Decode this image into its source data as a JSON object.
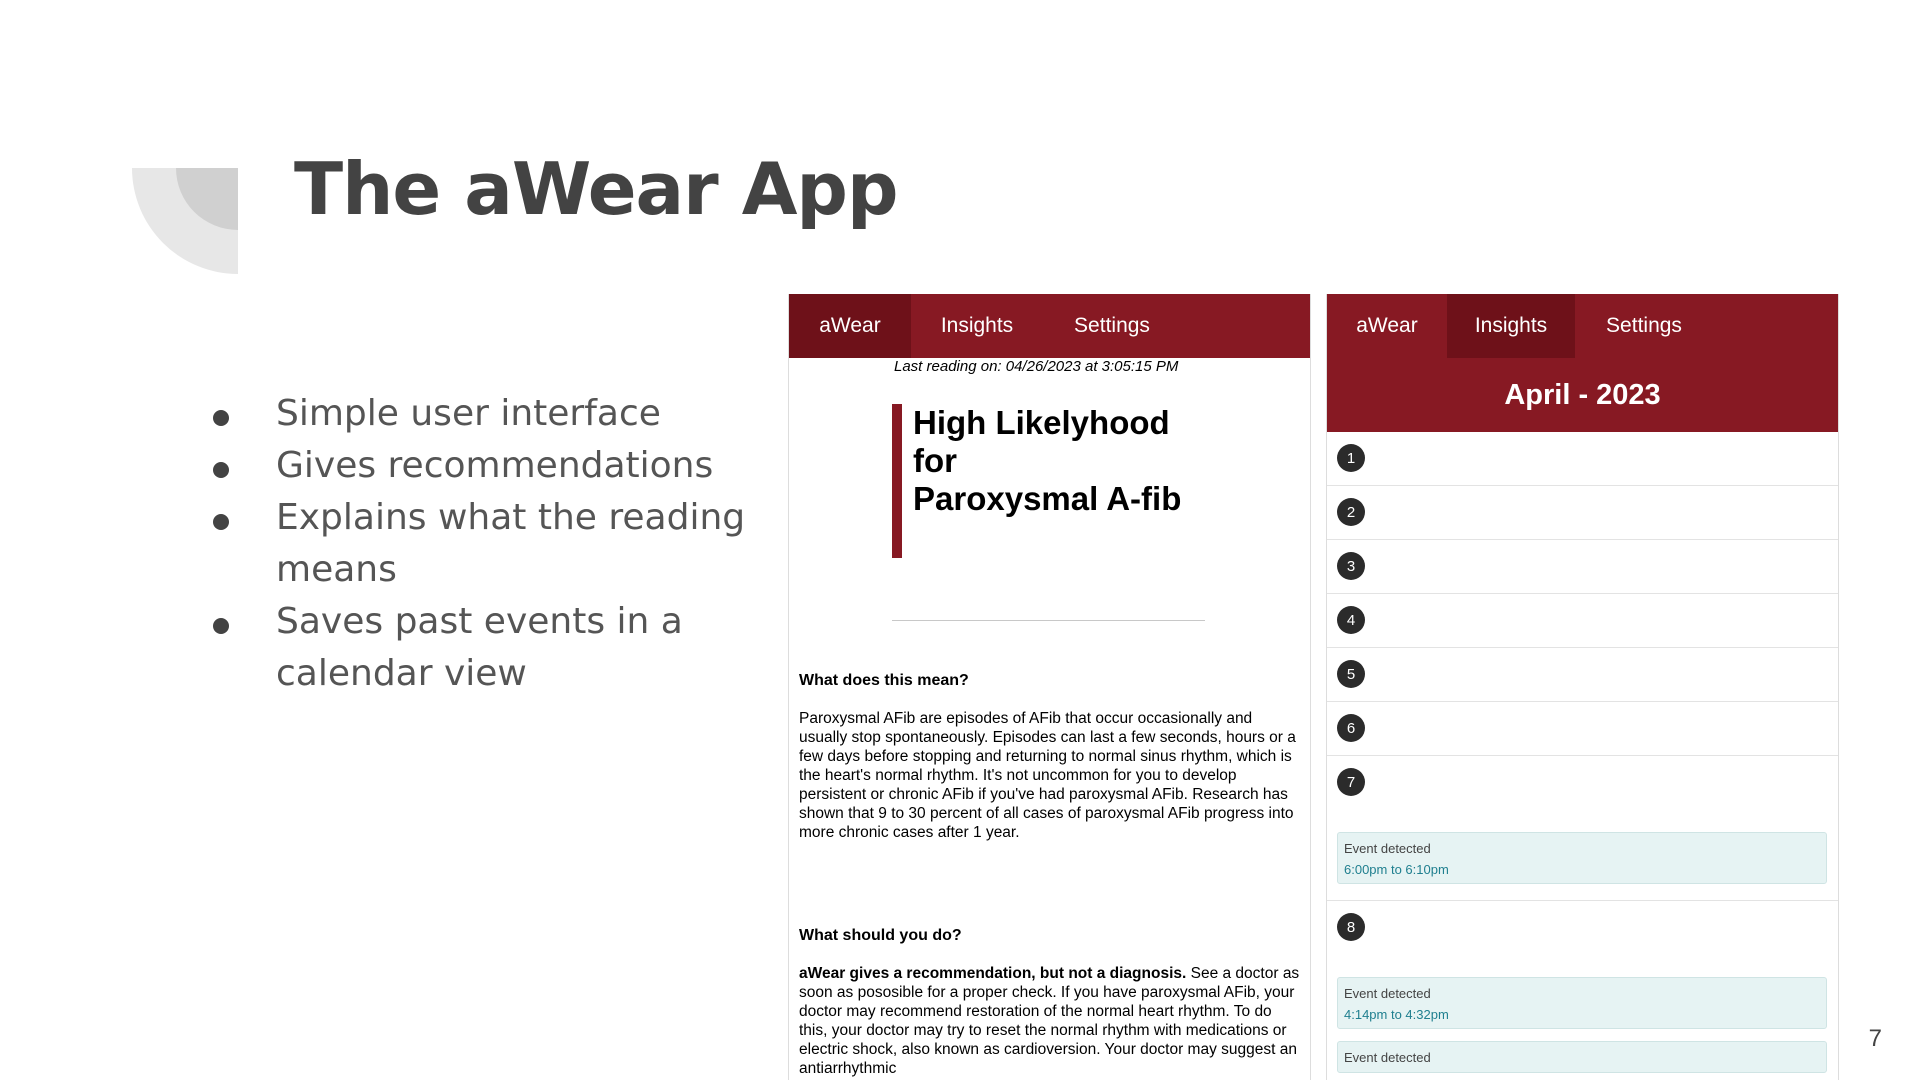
{
  "slide": {
    "title": "The aWear App",
    "bullets": [
      "Simple user interface",
      "Gives recommendations",
      "Explains what the reading means",
      "Saves past events in a calendar view"
    ],
    "page_number": "7"
  },
  "screen_result": {
    "nav": [
      "aWear",
      "Insights",
      "Settings"
    ],
    "active_tab": "aWear",
    "last_reading": "Last reading on: 04/26/2023 at 3:05:15 PM",
    "result_lines": [
      "High Likelyhood",
      "for",
      "Paroxysmal A-fib"
    ],
    "meaning_heading": "What does this mean?",
    "meaning_text": "Paroxysmal AFib are episodes of AFib that occur occasionally and usually stop spontaneously. Episodes can last a few seconds, hours or a few days before stopping and returning to normal sinus rhythm, which is the heart's normal rhythm. It's not uncommon for you to develop persistent or chronic AFib if you've had paroxysmal AFib. Research has shown that 9 to 30 percent of all cases of paroxysmal AFib progress into more chronic cases after 1 year.",
    "todo_heading": "What should you do?",
    "todo_bold": "aWear gives a recommendation, but not a diagnosis.",
    "todo_text": " See a doctor as soon as pososible for a proper check. If you have paroxysmal AFib, your doctor may recommend restoration of the normal heart rhythm. To do this, your doctor may try to reset the normal rhythm with medications or electric shock, also known as cardioversion. Your doctor may suggest an antiarrhythmic"
  },
  "screen_calendar": {
    "nav": [
      "aWear",
      "Insights",
      "Settings"
    ],
    "active_tab": "Insights",
    "month": "April - 2023",
    "days": [
      {
        "num": "1"
      },
      {
        "num": "2"
      },
      {
        "num": "3"
      },
      {
        "num": "4"
      },
      {
        "num": "5"
      },
      {
        "num": "6"
      },
      {
        "num": "7",
        "event": {
          "label": "Event detected",
          "time": "6:00pm to 6:10pm"
        }
      },
      {
        "num": "8",
        "event": {
          "label": "Event detected",
          "time": "4:14pm to 4:32pm"
        },
        "event2": {
          "label": "Event detected"
        }
      }
    ]
  },
  "colors": {
    "brand": "#871923",
    "brand_dark": "#6e1119",
    "event_bg": "#e6f3f3",
    "event_time": "#1f7f8f"
  }
}
